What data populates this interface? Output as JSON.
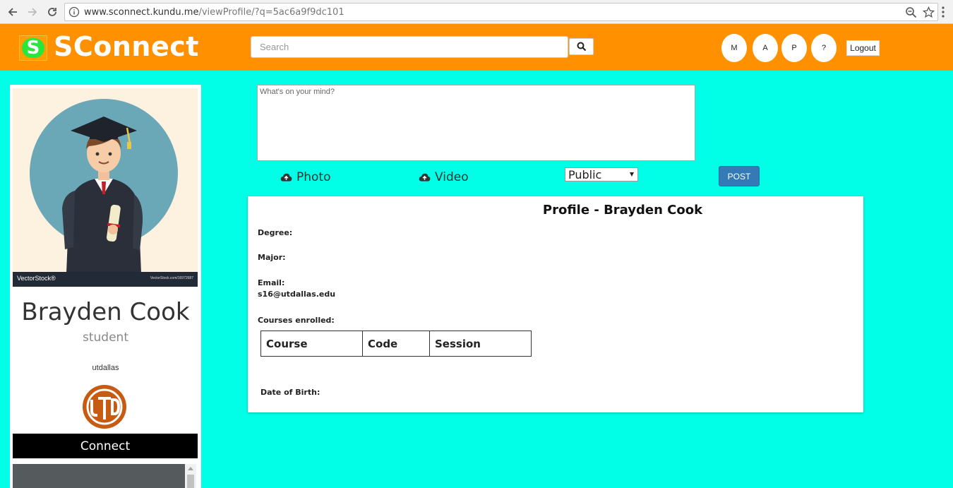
{
  "browser": {
    "url_host": "www.sconnect.kundu.me",
    "url_path": "/viewProfile/?q=5ac6a9f9dc101"
  },
  "header": {
    "brand_letter": "S",
    "brand": "SConnect",
    "search_placeholder": "Search",
    "circle_buttons": [
      "M",
      "A",
      "P",
      "?"
    ],
    "logout": "Logout",
    "colors": {
      "bar": "#ff9100",
      "logo_green": "#28e63c"
    }
  },
  "sidebar": {
    "watermark_left": "VectorStock®",
    "watermark_right": "VectorStock.com/16972687",
    "name": "Brayden Cook",
    "role": "student",
    "school": "utdallas",
    "connect": "Connect"
  },
  "composer": {
    "placeholder": "What's on your mind?",
    "photo": "Photo",
    "video": "Video",
    "visibility": "Public",
    "post": "POST"
  },
  "profile": {
    "title": "Profile - Brayden Cook",
    "degree_label": "Degree:",
    "major_label": "Major:",
    "email_label": "Email:",
    "email_value": "s16@utdallas.edu",
    "courses_label": "Courses enrolled:",
    "course_columns": [
      "Course",
      "Code",
      "Session"
    ],
    "dob_label": "Date of Birth:"
  },
  "colors": {
    "page_bg": "#00ffe6",
    "post_button": "#337ab7"
  }
}
